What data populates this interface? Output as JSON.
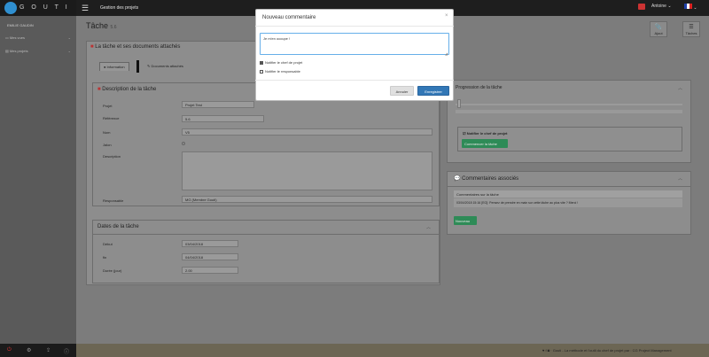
{
  "sidebar": {
    "brand": "G O U T I",
    "user": "EMILIE GAUDIN",
    "items": [
      {
        "label": "Mes vues"
      },
      {
        "label": "Mes projets"
      }
    ]
  },
  "topbar": {
    "title": "Gestion des projets",
    "user": "Antoine",
    "notif_count": "1"
  },
  "page": {
    "title": "Tâche",
    "title_sub": "5.6",
    "btn_ajout": "Ajout",
    "btn_taches": "Tâches"
  },
  "left_card": {
    "heading": "La tâche et ses documents attachés",
    "tab_info": "Information",
    "tab_docs": "Documents attachés",
    "desc_heading": "Description de la tâche",
    "fields": {
      "projet_label": "Projet",
      "projet_value": "Projet Test",
      "reference_label": "Référence",
      "reference_value": "5.6",
      "nom_label": "Nom",
      "nom_value": "V5",
      "jalon_label": "Jalon",
      "description_label": "Description",
      "responsable_label": "Responsable",
      "responsable_value": "MG (Membre Gouti)"
    },
    "dates_heading": "Dates de la tâche",
    "dates": {
      "debut_label": "Début",
      "debut_value": "03/04/2018",
      "fin_label": "fin",
      "fin_value": "04/04/2018",
      "duree_label": "Durée (jour)",
      "duree_value": "2.00"
    }
  },
  "right_card": {
    "progress_heading": "Progression de la tâche",
    "notify_label": "Notifier le chef de projet",
    "btn_commencer": "Commencer la tâche",
    "comments_heading": "Commentaires associés",
    "comments_sub": "Commentaires sur la tâche",
    "comment_line": "03/04/2018 15:16 [EG]: Pensez de prendre en main sur cette tâche au plus vite ? Merci !",
    "btn_nouveau": "Nouveau"
  },
  "modal": {
    "title": "Nouveau commentaire",
    "textarea_value": "Je m'en occupe !",
    "chk_chef": "Notifier le chef de projet",
    "chk_resp": "Notifier le responsable",
    "cancel": "Annuler",
    "save": "Enregistrer"
  },
  "footer": {
    "text": "Gouti - La méthode et l'outil du chef de projet par : CG Project Management"
  },
  "colors": {
    "accent": "#3277b6",
    "success": "#2e8b57",
    "topbar": "#1e1e1e"
  }
}
